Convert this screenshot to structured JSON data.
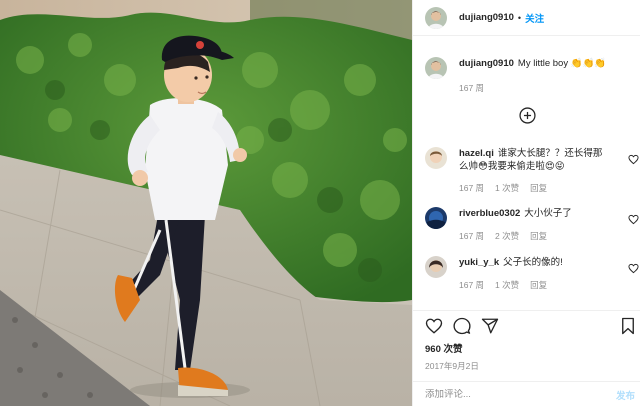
{
  "post": {
    "author": "dujiang0910",
    "follow_label": "关注",
    "separator": "•"
  },
  "caption": {
    "author": "dujiang0910",
    "text": "My little boy 👏👏👏",
    "age": "167 周"
  },
  "comments": [
    {
      "user": "hazel.qi",
      "text_line1": "谁家大长腿？？还长得那",
      "text_line2": "么帅😳我要来偷走啦😍😝",
      "age": "167 周",
      "likes": "1 次赞",
      "reply": "回复"
    },
    {
      "user": "riverblue0302",
      "text_line1": "大小伙子了",
      "text_line2": "",
      "age": "167 周",
      "likes": "2 次赞",
      "reply": "回复"
    },
    {
      "user": "yuki_y_k",
      "text_line1": "父子长的像的!",
      "text_line2": "",
      "age": "167 周",
      "likes": "1 次赞",
      "reply": "回复"
    }
  ],
  "engagement": {
    "likes": "960 次赞",
    "date": "2017年9月2日"
  },
  "composer": {
    "placeholder": "添加评论...",
    "post_label": "发布"
  },
  "icons": {
    "load_more": "plus-circle-icon",
    "like": "heart-icon",
    "comment": "comment-icon",
    "share": "share-icon",
    "save": "bookmark-icon"
  },
  "colors": {
    "link_blue": "#0095f6",
    "muted_text": "#8e8e8e",
    "post_disabled": "#b2dffc",
    "divider": "#efefef"
  }
}
